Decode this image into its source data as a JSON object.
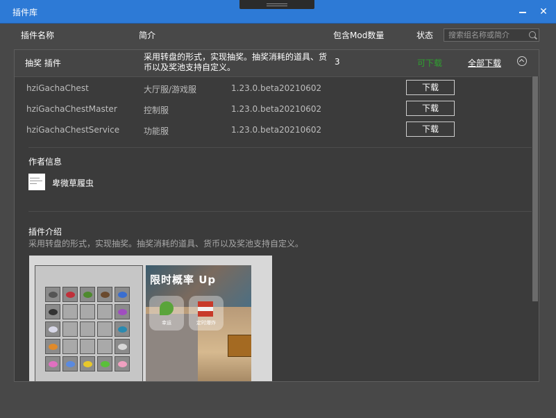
{
  "window": {
    "title": "插件库"
  },
  "columns": {
    "name": "插件名称",
    "desc": "简介",
    "count": "包含Mod数量",
    "status": "状态"
  },
  "search": {
    "placeholder": "搜索组名称或简介"
  },
  "plugin": {
    "name": "抽奖 插件",
    "desc": "采用转盘的形式，实现抽奖。抽奖消耗的道具、货币以及奖池支持自定义。",
    "count": "3",
    "status": "可下载",
    "download_all": "全部下载",
    "mods": [
      {
        "name": "hziGachaChest",
        "type": "大厅服/游戏服",
        "version": "1.23.0.beta20210602",
        "action": "下载"
      },
      {
        "name": "hziGachaChestMaster",
        "type": "控制服",
        "version": "1.23.0.beta20210602",
        "action": "下载"
      },
      {
        "name": "hziGachaChestService",
        "type": "功能服",
        "version": "1.23.0.beta20210602",
        "action": "下载"
      }
    ],
    "author_title": "作者信息",
    "author_name": "卑微草履虫",
    "intro_title": "插件介绍",
    "intro_text": "采用转盘的形式，实现抽奖。抽奖消耗的道具、货币以及奖池支持自定义。",
    "preview": {
      "cover_title": "限时概率 Up",
      "card1_label": "幸运",
      "card2_label": "定时爆炸"
    }
  },
  "colors": {
    "titlebar": "#2d7ad6",
    "background": "#484848",
    "panel": "#3b3b3b",
    "status_green": "#2fa12f"
  },
  "icons": [
    "minimize-icon",
    "close-icon",
    "search-icon",
    "collapse-up-icon"
  ]
}
